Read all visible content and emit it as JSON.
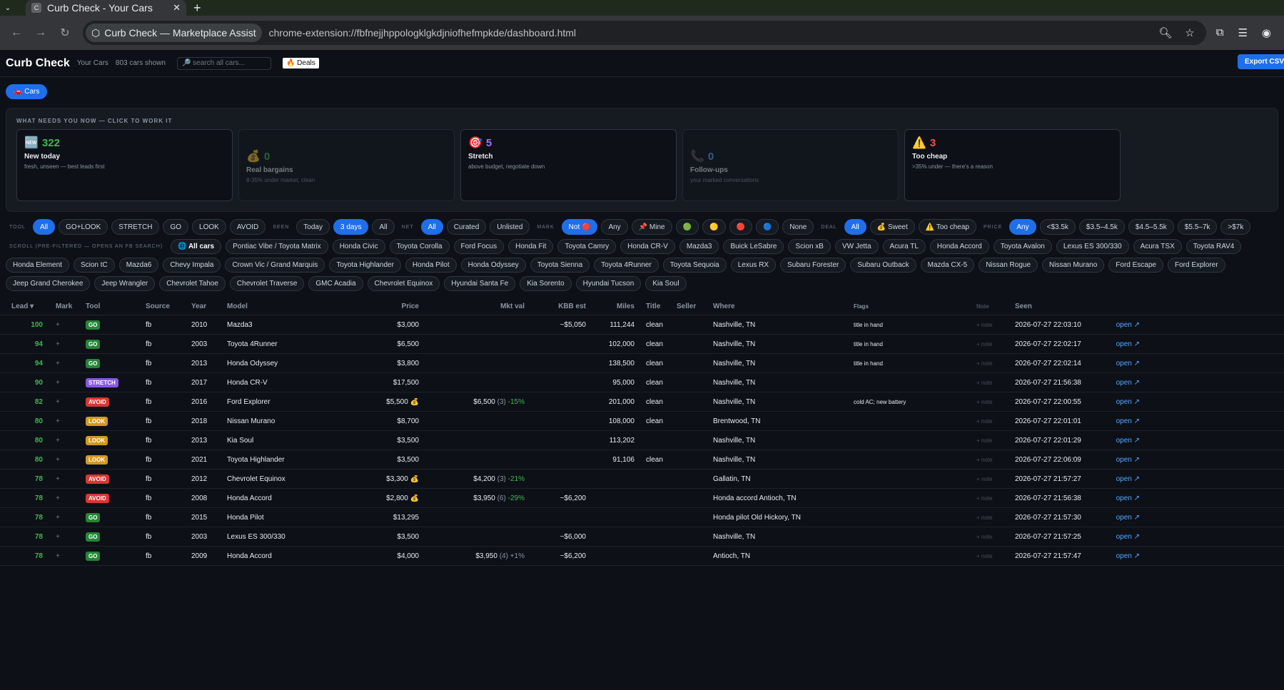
{
  "browser": {
    "tab_title": "Curb Check - Your Cars",
    "tab_favicon": "C",
    "site_chip": "Curb Check — Marketplace Assist",
    "url": "chrome-extension://fbfnejjhppologklgkdjniofhefmpkde/dashboard.html"
  },
  "header": {
    "title": "Curb Check",
    "subtitle": "Your Cars",
    "count": "803 cars shown",
    "search_placeholder": "🔎 search all cars...",
    "deals": "🔥 Deals",
    "export": "Export CSV"
  },
  "tabs": {
    "cars": "🚗 Cars"
  },
  "needs": {
    "heading": "WHAT NEEDS YOU NOW — CLICK TO WORK IT",
    "cards": [
      {
        "icon": "🆕",
        "count": "322",
        "label": "New today",
        "desc": "fresh, unseen — best leads first",
        "color": "#3fb950"
      },
      {
        "icon": "💰",
        "count": "0",
        "label": "Real bargains",
        "desc": "8-35% under market, clean",
        "color": "#3fb950"
      },
      {
        "icon": "🎯",
        "count": "5",
        "label": "Stretch",
        "desc": "above budget, negotiate down",
        "color": "#a371f7"
      },
      {
        "icon": "📞",
        "count": "0",
        "label": "Follow-ups",
        "desc": "your marked conversations",
        "color": "#58a6ff"
      },
      {
        "icon": "⚠️",
        "count": "3",
        "label": "Too cheap",
        "desc": ">35% under — there's a reason",
        "color": "#f85149"
      }
    ]
  },
  "filters": {
    "tool_label": "TOOL",
    "tool": [
      "All",
      "GO+LOOK",
      "STRETCH",
      "GO",
      "LOOK",
      "AVOID"
    ],
    "seen_label": "SEEN",
    "seen": [
      "Today",
      "3 days",
      "All"
    ],
    "net_label": "NET",
    "net": [
      "All",
      "Curated",
      "Unlisted"
    ],
    "mark_label": "MARK",
    "mark": [
      "Not 🔴",
      "Any",
      "📌 Mine",
      "🟢",
      "🟡",
      "🔴",
      "🔵",
      "None"
    ],
    "deal_label": "DEAL",
    "deal": [
      "All",
      "💰 Sweet",
      "⚠️ Too cheap"
    ],
    "price_label": "PRICE",
    "price": [
      "Any",
      "<$3.5k",
      "$3.5–4.5k",
      "$4.5–5.5k",
      "$5.5–7k",
      ">$7k"
    ]
  },
  "scroll": {
    "label": "SCROLL (PRE-FILTERED — OPENS AN FB SEARCH)",
    "items": [
      "🌐 All cars",
      "Pontiac Vibe / Toyota Matrix",
      "Honda Civic",
      "Toyota Corolla",
      "Ford Focus",
      "Honda Fit",
      "Toyota Camry",
      "Honda CR-V",
      "Mazda3",
      "Buick LeSabre",
      "Scion xB",
      "VW Jetta",
      "Acura TL",
      "Honda Accord",
      "Toyota Avalon",
      "Lexus ES 300/330",
      "Acura TSX",
      "Toyota RAV4",
      "Honda Element",
      "Scion tC",
      "Mazda6",
      "Chevy Impala",
      "Crown Vic / Grand Marquis",
      "Toyota Highlander",
      "Honda Pilot",
      "Honda Odyssey",
      "Toyota Sienna",
      "Toyota 4Runner",
      "Toyota Sequoia",
      "Lexus RX",
      "Subaru Forester",
      "Subaru Outback",
      "Mazda CX-5",
      "Nissan Rogue",
      "Nissan Murano",
      "Ford Escape",
      "Ford Explorer",
      "Jeep Grand Cherokee",
      "Jeep Wrangler",
      "Chevrolet Tahoe",
      "Chevrolet Traverse",
      "GMC Acadia",
      "Chevrolet Equinox",
      "Hyundai Santa Fe",
      "Kia Sorento",
      "Hyundai Tucson",
      "Kia Soul"
    ]
  },
  "table": {
    "columns": [
      "Lead ▾",
      "Mark",
      "Tool",
      "Source",
      "Year",
      "Model",
      "Price",
      "Mkt val",
      "KBB est",
      "Miles",
      "Title",
      "Seller",
      "Where",
      "Flags",
      "Note",
      "Seen",
      ""
    ],
    "rows": [
      {
        "lead": "100",
        "mark": "+",
        "tool": "GO",
        "source": "fb",
        "year": "2010",
        "model": "Mazda3",
        "price": "$3,000",
        "mkt": "",
        "mkt_cnt": "",
        "mkt_pct": "",
        "kbb": "~$5,050",
        "miles": "111,244",
        "title": "clean",
        "seller": "",
        "where": "Nashville, TN",
        "flags": "title in hand",
        "note": "+ note",
        "seen": "2026-07-27 22:03:10",
        "open": "open ↗"
      },
      {
        "lead": "94",
        "mark": "+",
        "tool": "GO",
        "source": "fb",
        "year": "2003",
        "model": "Toyota 4Runner",
        "price": "$6,500",
        "mkt": "",
        "mkt_cnt": "",
        "mkt_pct": "",
        "kbb": "",
        "miles": "102,000",
        "title": "clean",
        "seller": "",
        "where": "Nashville, TN",
        "flags": "title in hand",
        "note": "+ note",
        "seen": "2026-07-27 22:02:17",
        "open": "open ↗"
      },
      {
        "lead": "94",
        "mark": "+",
        "tool": "GO",
        "source": "fb",
        "year": "2013",
        "model": "Honda Odyssey",
        "price": "$3,800",
        "mkt": "",
        "mkt_cnt": "",
        "mkt_pct": "",
        "kbb": "",
        "miles": "138,500",
        "title": "clean",
        "seller": "",
        "where": "Nashville, TN",
        "flags": "title in hand",
        "note": "+ note",
        "seen": "2026-07-27 22:02:14",
        "open": "open ↗"
      },
      {
        "lead": "90",
        "mark": "+",
        "tool": "STRETCH",
        "source": "fb",
        "year": "2017",
        "model": "Honda CR-V",
        "price": "$17,500",
        "mkt": "",
        "mkt_cnt": "",
        "mkt_pct": "",
        "kbb": "",
        "miles": "95,000",
        "title": "clean",
        "seller": "",
        "where": "Nashville, TN",
        "flags": "",
        "note": "+ note",
        "seen": "2026-07-27 21:56:38",
        "open": "open ↗"
      },
      {
        "lead": "82",
        "mark": "+",
        "tool": "AVOID",
        "source": "fb",
        "year": "2016",
        "model": "Ford Explorer",
        "price": "$5,500 💰",
        "mkt": "$6,500",
        "mkt_cnt": "(3)",
        "mkt_pct": "-15%",
        "kbb": "",
        "miles": "201,000",
        "title": "clean",
        "seller": "",
        "where": "Nashville, TN",
        "flags": "cold AC; new battery",
        "note": "+ note",
        "seen": "2026-07-27 22:00:55",
        "open": "open ↗"
      },
      {
        "lead": "80",
        "mark": "+",
        "tool": "LOOK",
        "source": "fb",
        "year": "2018",
        "model": "Nissan Murano",
        "price": "$8,700",
        "mkt": "",
        "mkt_cnt": "",
        "mkt_pct": "",
        "kbb": "",
        "miles": "108,000",
        "title": "clean",
        "seller": "",
        "where": "Brentwood, TN",
        "flags": "",
        "note": "+ note",
        "seen": "2026-07-27 22:01:01",
        "open": "open ↗"
      },
      {
        "lead": "80",
        "mark": "+",
        "tool": "LOOK",
        "source": "fb",
        "year": "2013",
        "model": "Kia Soul",
        "price": "$3,500",
        "mkt": "",
        "mkt_cnt": "",
        "mkt_pct": "",
        "kbb": "",
        "miles": "113,202",
        "title": "",
        "seller": "",
        "where": "Nashville, TN",
        "flags": "",
        "note": "+ note",
        "seen": "2026-07-27 22:01:29",
        "open": "open ↗"
      },
      {
        "lead": "80",
        "mark": "+",
        "tool": "LOOK",
        "source": "fb",
        "year": "2021",
        "model": "Toyota Highlander",
        "price": "$3,500",
        "mkt": "",
        "mkt_cnt": "",
        "mkt_pct": "",
        "kbb": "",
        "miles": "91,106",
        "title": "clean",
        "seller": "",
        "where": "Nashville, TN",
        "flags": "",
        "note": "+ note",
        "seen": "2026-07-27 22:06:09",
        "open": "open ↗"
      },
      {
        "lead": "78",
        "mark": "+",
        "tool": "AVOID",
        "source": "fb",
        "year": "2012",
        "model": "Chevrolet Equinox",
        "price": "$3,300 💰",
        "mkt": "$4,200",
        "mkt_cnt": "(3)",
        "mkt_pct": "-21%",
        "kbb": "",
        "miles": "",
        "title": "",
        "seller": "",
        "where": "Gallatin, TN",
        "flags": "",
        "note": "+ note",
        "seen": "2026-07-27 21:57:27",
        "open": "open ↗"
      },
      {
        "lead": "78",
        "mark": "+",
        "tool": "AVOID",
        "source": "fb",
        "year": "2008",
        "model": "Honda Accord",
        "price": "$2,800 💰",
        "mkt": "$3,950",
        "mkt_cnt": "(6)",
        "mkt_pct": "-29%",
        "kbb": "~$6,200",
        "miles": "",
        "title": "",
        "seller": "",
        "where": "Honda accord Antioch, TN",
        "flags": "",
        "note": "+ note",
        "seen": "2026-07-27 21:56:38",
        "open": "open ↗"
      },
      {
        "lead": "78",
        "mark": "+",
        "tool": "GO",
        "source": "fb",
        "year": "2015",
        "model": "Honda Pilot",
        "price": "$13,295",
        "mkt": "",
        "mkt_cnt": "",
        "mkt_pct": "",
        "kbb": "",
        "miles": "",
        "title": "",
        "seller": "",
        "where": "Honda pilot Old Hickory, TN",
        "flags": "",
        "note": "+ note",
        "seen": "2026-07-27 21:57:30",
        "open": "open ↗"
      },
      {
        "lead": "78",
        "mark": "+",
        "tool": "GO",
        "source": "fb",
        "year": "2003",
        "model": "Lexus ES 300/330",
        "price": "$3,500",
        "mkt": "",
        "mkt_cnt": "",
        "mkt_pct": "",
        "kbb": "~$6,000",
        "miles": "",
        "title": "",
        "seller": "",
        "where": "Nashville, TN",
        "flags": "",
        "note": "+ note",
        "seen": "2026-07-27 21:57:25",
        "open": "open ↗"
      },
      {
        "lead": "78",
        "mark": "+",
        "tool": "GO",
        "source": "fb",
        "year": "2009",
        "model": "Honda Accord",
        "price": "$4,000",
        "mkt": "$3,950",
        "mkt_cnt": "(4)",
        "mkt_pct": "+1%",
        "kbb": "~$6,200",
        "miles": "",
        "title": "",
        "seller": "",
        "where": "Antioch, TN",
        "flags": "",
        "note": "+ note",
        "seen": "2026-07-27 21:57:47",
        "open": "open ↗"
      }
    ]
  }
}
